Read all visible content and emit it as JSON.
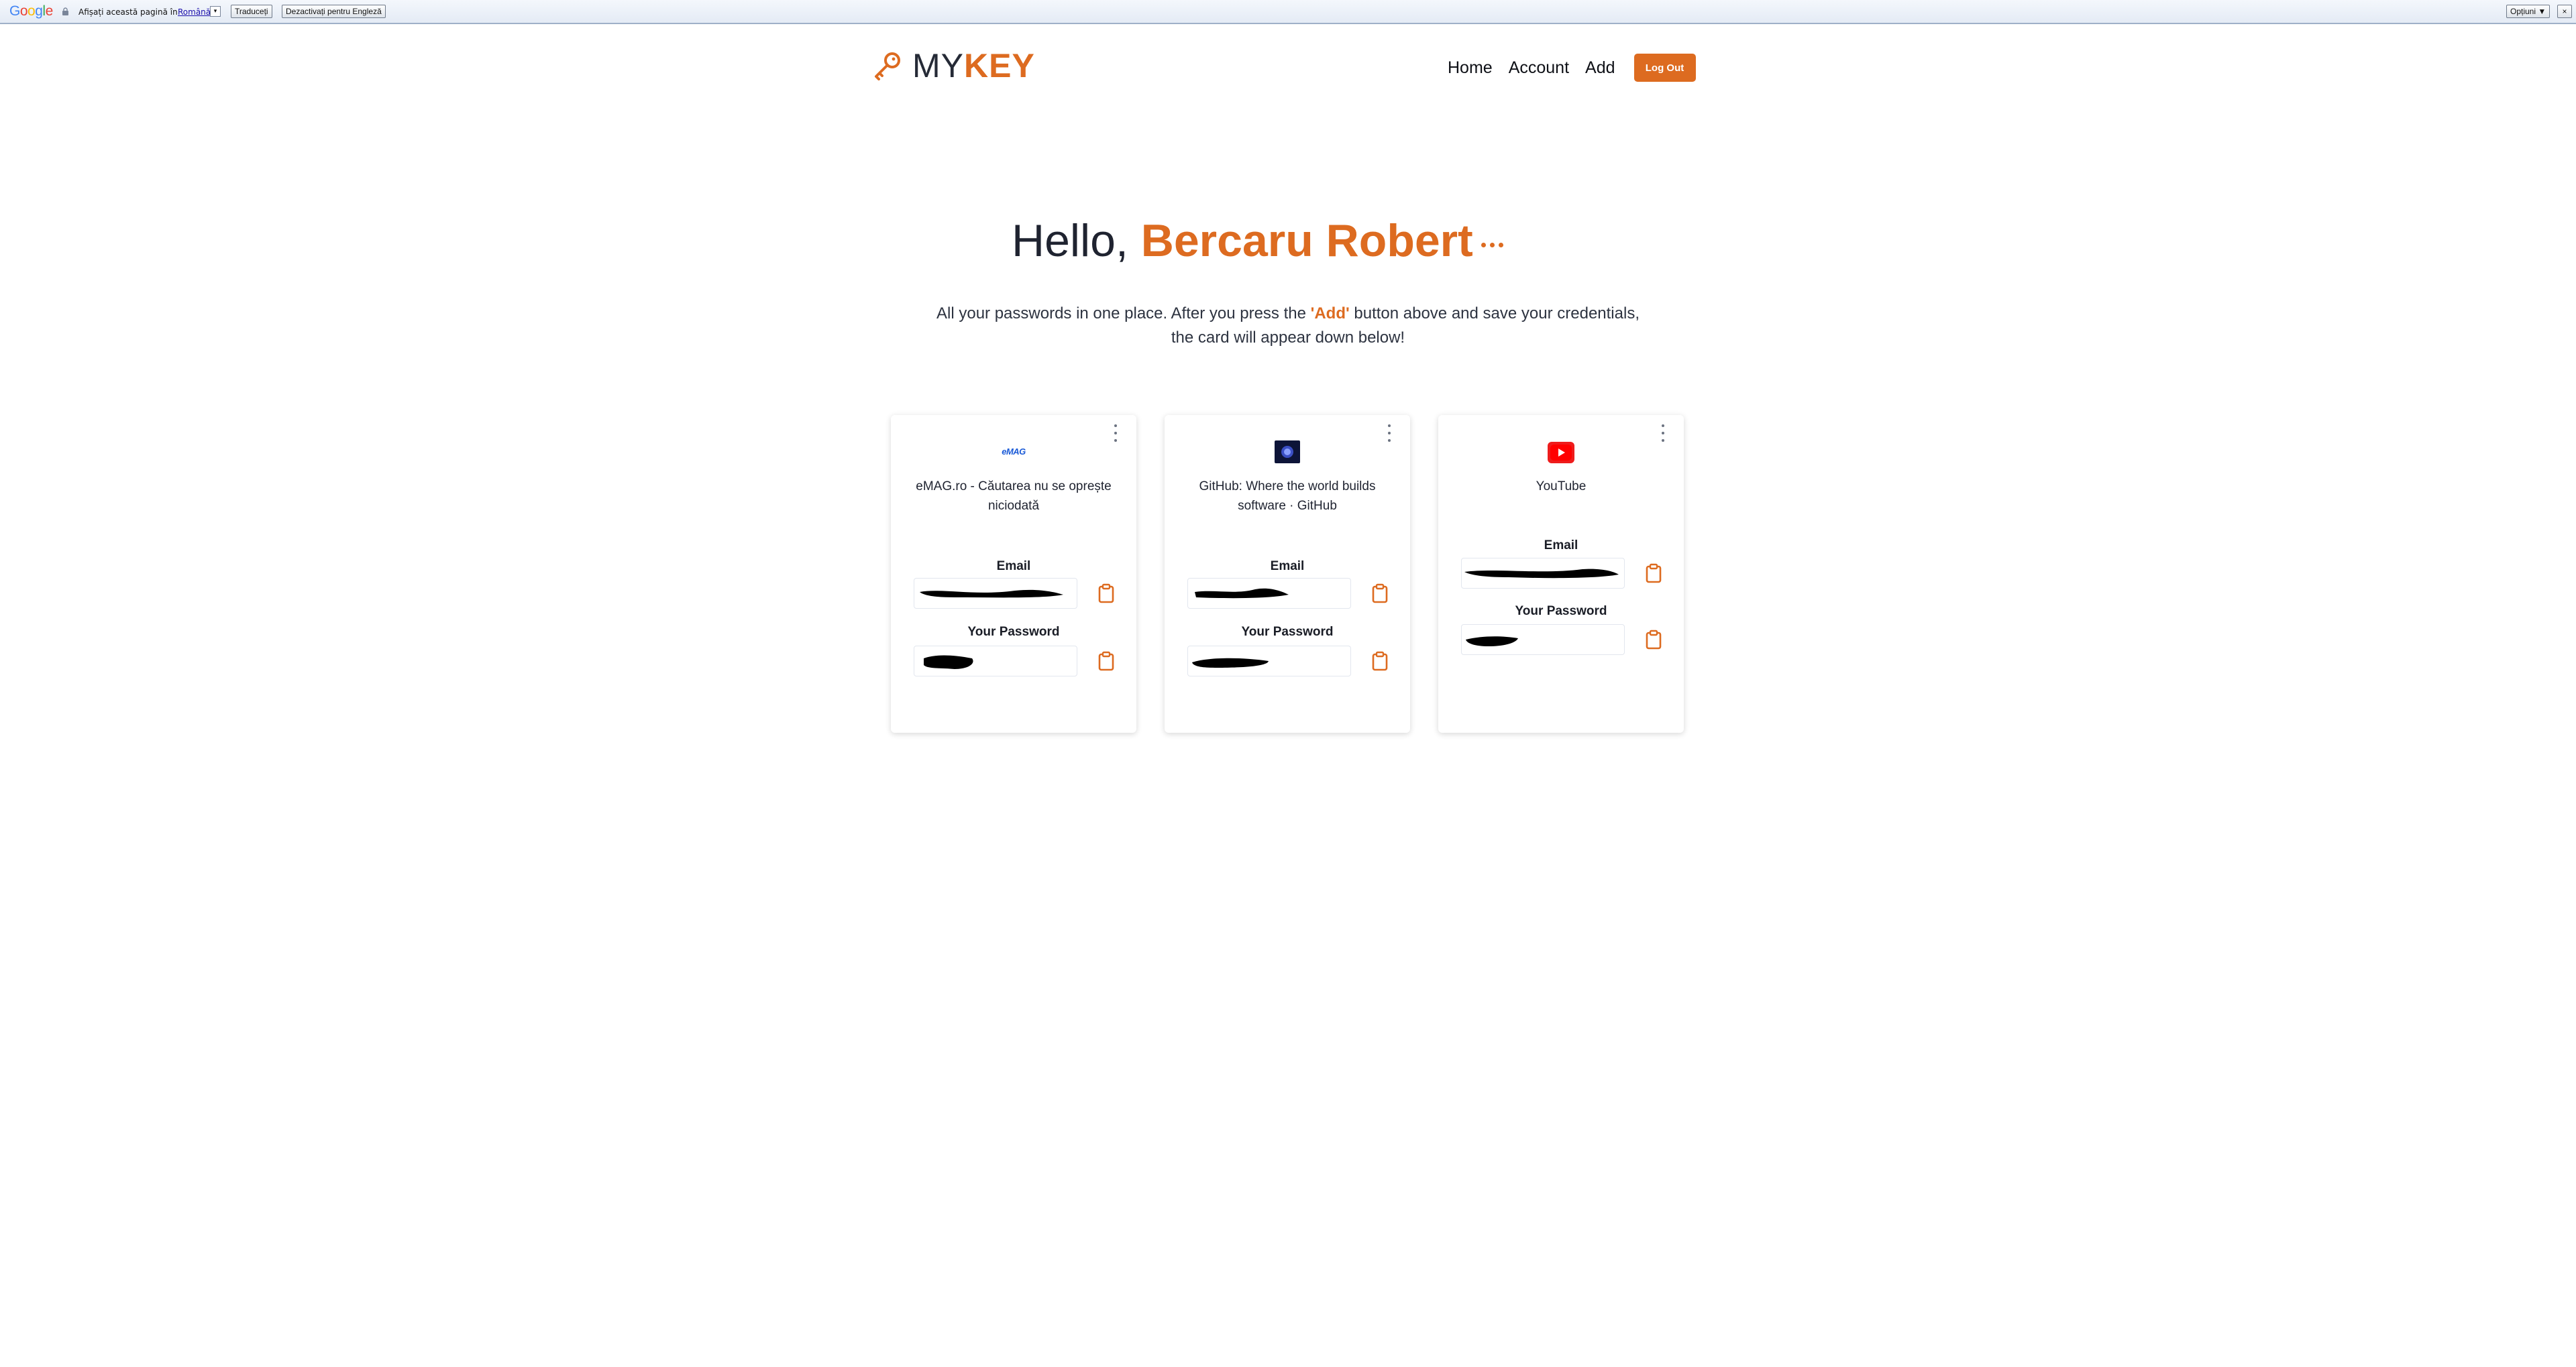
{
  "translate_bar": {
    "logo": "Google",
    "prompt": "Afișați această pagină în",
    "language": "Română",
    "translate_button": "Traduceți",
    "disable_button": "Dezactivați pentru Engleză",
    "options_button": "Opțiuni ▼",
    "close_button": "×"
  },
  "nav": {
    "logo_my": "MY",
    "logo_key": "KEY",
    "links": [
      "Home",
      "Account",
      "Add"
    ],
    "logout": "Log Out",
    "accent_color": "#dd6b20"
  },
  "hero": {
    "greeting": "Hello, ",
    "name": "Bercaru Robert",
    "desc_before": "All your passwords in one place. After you press the ",
    "desc_highlight": "'Add'",
    "desc_after": " button above and save your credentials, the card will appear down below!"
  },
  "cards": [
    {
      "logo_icon": "emag-logo-icon",
      "logo_text": "eMAG",
      "title": "eMAG.ro - Căutarea nu se oprește niciodată",
      "email_label": "Email",
      "password_label": "Your Password"
    },
    {
      "logo_icon": "github-logo-icon",
      "title": "GitHub: Where the world builds software · GitHub",
      "email_label": "Email",
      "password_label": "Your Password"
    },
    {
      "logo_icon": "youtube-logo-icon",
      "title": "YouTube",
      "email_label": "Email",
      "password_label": "Your Password"
    }
  ]
}
